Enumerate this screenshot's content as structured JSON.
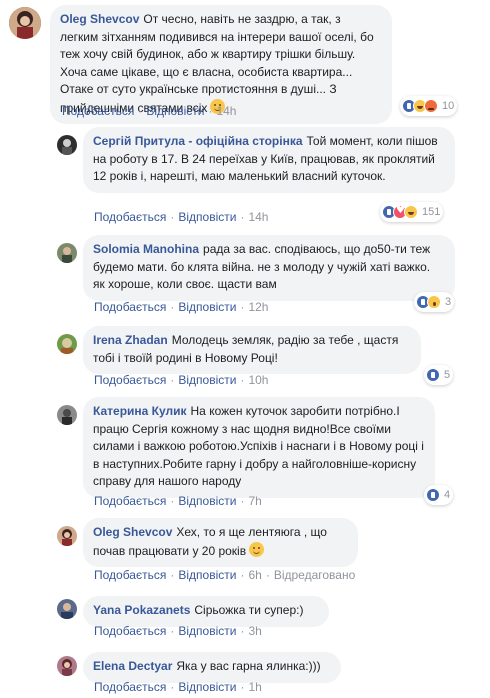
{
  "actions": {
    "like": "Подобається",
    "reply": "Відповісти",
    "edited": "Відредаговано"
  },
  "comments": [
    {
      "author": "Oleg Shevcov",
      "text": "От чесно, навіть не заздрю, а так, з легким зітханням подивився на інтерери вашої оселі, бо теж хочу свій будинок, або ж квартиру трішки більшу. Хоча саме цікаве, що є власна, особиста квартира... Отаке от суто українське протистояння в душі... З прийдешніми святами всіх",
      "time": "14h",
      "reactions": [
        "like",
        "haha",
        "angry"
      ],
      "reaction_count": "10"
    },
    {
      "author": "Сергій Притула - офіційна сторінка",
      "text": "Той момент, коли пішов на роботу в 17. В 24 переїхав у Київ, працював, як проклятий 12 років і, нарешті, маю маленький власний куточок.",
      "time": "14h",
      "reactions": [
        "like",
        "love",
        "haha"
      ],
      "reaction_count": "151"
    },
    {
      "author": "Solomia Manohina",
      "text": "рада за вас. сподіваюсь, що до50-ти теж будемо мати. бо клята війна. не з молоду у чужій хаті важко. як хороше, коли своє. щасти вам",
      "time": "12h",
      "reactions": [
        "like",
        "wow"
      ],
      "reaction_count": "3"
    },
    {
      "author": "Irena Zhadan",
      "text": "Молодець земляк, радію за тебе , щастя тобі і твоїй родині в Новому Році!",
      "time": "10h",
      "reactions": [
        "like"
      ],
      "reaction_count": "5"
    },
    {
      "author": "Катерина Кулик",
      "text": "На кожен куточок заробити потрібно.І працю Сергія кожному з нас щодня видно!Все своїми силами і важкою роботою.Успіхів і наснаги і в Новому році і в наступних.Робите гарну і добру а найголовніше-корисну справу для нашого народу",
      "time": "7h",
      "reactions": [
        "like"
      ],
      "reaction_count": "4"
    },
    {
      "author": "Oleg Shevcov",
      "text": "Хех, то я ще лентяюга , що почав працювати у 20 років",
      "time": "6h"
    },
    {
      "author": "Yana Pokazanets",
      "text": "Сірьожка ти супер:)",
      "time": "3h"
    },
    {
      "author": "Elena Dectyar",
      "text": "Яка у вас гарна ялинка:)))",
      "time": "1h"
    }
  ]
}
